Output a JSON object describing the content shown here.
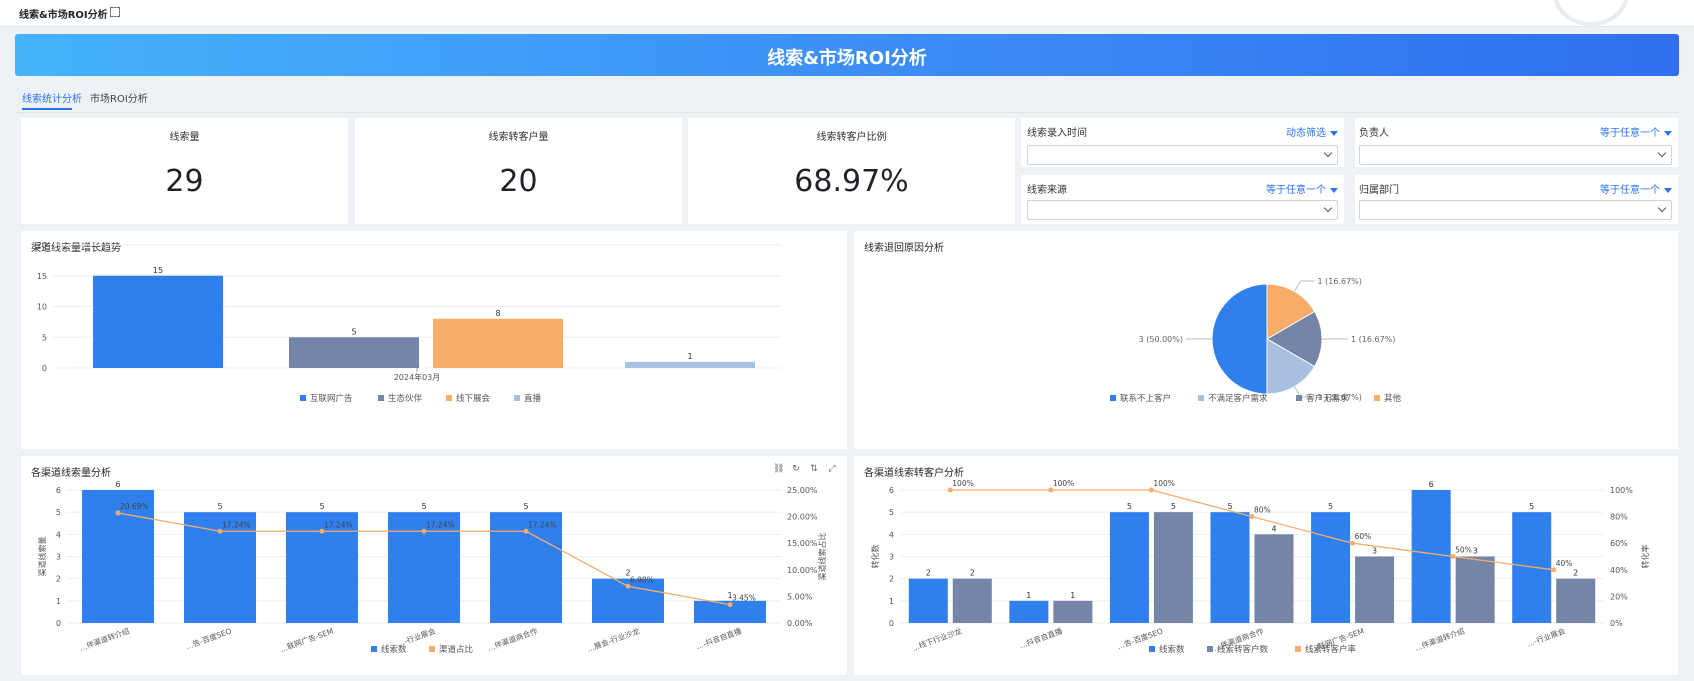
{
  "window": {
    "title": "线索&市场ROI分析"
  },
  "banner": {
    "title": "线索&市场ROI分析"
  },
  "tabs": [
    {
      "label": "线索统计分析",
      "active": true
    },
    {
      "label": "市场ROI分析",
      "active": false
    }
  ],
  "kpis": [
    {
      "title": "线索量",
      "value": "29"
    },
    {
      "title": "线索转客户量",
      "value": "20"
    },
    {
      "title": "线索转客户比例",
      "value": "68.97%"
    }
  ],
  "filters": [
    {
      "label": "线索录入时间",
      "op": "动态筛选"
    },
    {
      "label": "负责人",
      "op": "等于任意一个"
    },
    {
      "label": "线索来源",
      "op": "等于任意一个"
    },
    {
      "label": "归属部门",
      "op": "等于任意一个"
    }
  ],
  "colors": {
    "blue": "#2f7fec",
    "slate": "#7585a8",
    "orange": "#f7ad67",
    "lightblue": "#a8bfe0",
    "accent": "#2a73f0"
  },
  "chart_data": [
    {
      "type": "bar",
      "title": "渠道线索量增长趋势",
      "categories": [
        "2024年03月"
      ],
      "series": [
        {
          "name": "互联网广告",
          "values": [
            15
          ]
        },
        {
          "name": "生态伙伴",
          "values": [
            5
          ]
        },
        {
          "name": "线下展会",
          "values": [
            8
          ]
        },
        {
          "name": "直播",
          "values": [
            1
          ]
        }
      ],
      "yticks": [
        "0",
        "5",
        "10",
        "15",
        "20"
      ],
      "ylim": [
        0,
        20
      ],
      "legend": "bottom"
    },
    {
      "type": "pie",
      "title": "线索退回原因分析",
      "slices": [
        {
          "name": "联系不上客户",
          "value": 3,
          "label": "3 (50.00%)"
        },
        {
          "name": "不满足客户需求",
          "value": 1,
          "label": "1 (16.67%)"
        },
        {
          "name": "客户无需求",
          "value": 1,
          "label": "1 (16.67%)"
        },
        {
          "name": "其他",
          "value": 1,
          "label": "1 (16.67%)"
        }
      ],
      "legend": "bottom"
    },
    {
      "type": "bar",
      "title": "各渠道线索量分析",
      "categories": [
        "生态伙伴-渠道转介绍",
        "互联网广告-百度SEO",
        "互联网广告-SEM",
        "线下展会-行业展会",
        "生态伙伴-渠道商合作",
        "线下展会-行业沙龙",
        "直播-抖音自直播"
      ],
      "category_labels": [
        "…伴渠道转介绍",
        "…告-百度SEO",
        "…联网广告-SEM",
        "…-行业展会",
        "…伴渠道商合作",
        "…展会-行业沙龙",
        "…-抖音自直播"
      ],
      "series": [
        {
          "name": "线索数",
          "type": "bar",
          "values": [
            6,
            5,
            5,
            5,
            5,
            2,
            1
          ]
        },
        {
          "name": "渠道占比",
          "type": "line",
          "values": [
            20.69,
            17.24,
            17.24,
            17.24,
            17.24,
            6.9,
            3.45
          ],
          "labels": [
            "20.69%",
            "17.24%",
            "17.24%",
            "17.24%",
            "17.24%",
            "6.90%",
            "3.45%"
          ]
        }
      ],
      "ylabel": "渠道线索量",
      "y2label": "渠道线索占比",
      "yticks": [
        "0",
        "1",
        "2",
        "3",
        "4",
        "5",
        "6"
      ],
      "y2ticks": [
        "0.00%",
        "5.00%",
        "10.00%",
        "15.00%",
        "20.00%",
        "25.00%"
      ],
      "ylim": [
        0,
        6
      ],
      "y2lim": [
        0,
        25
      ],
      "legend": "bottom"
    },
    {
      "type": "bar",
      "title": "各渠道线索转客户分析",
      "categories": [
        "线下展会-行业沙龙",
        "直播-抖音自直播",
        "互联网广告-百度SEO",
        "生态伙伴-渠道商合作",
        "互联网广告-SEM",
        "生态伙伴-渠道转介绍",
        "线下展会-行业展会"
      ],
      "category_labels": [
        "…线下行业沙龙",
        "…抖音自直播",
        "…告-百度SEO",
        "…伴渠道商合作",
        "…联网广告-SEM",
        "…伴渠道转介绍",
        "…-行业展会"
      ],
      "series": [
        {
          "name": "线索数",
          "type": "bar",
          "values": [
            2,
            1,
            5,
            5,
            5,
            6,
            5
          ]
        },
        {
          "name": "线索转客户数",
          "type": "bar",
          "values": [
            2,
            1,
            5,
            4,
            3,
            3,
            2
          ]
        },
        {
          "name": "线索转客户率",
          "type": "line",
          "values": [
            100,
            100,
            100,
            80,
            60,
            50,
            40
          ],
          "labels": [
            "100%",
            "100%",
            "100%",
            "80%",
            "60%",
            "50%",
            "40%"
          ]
        }
      ],
      "ylabel": "转化数",
      "y2label": "转化率",
      "yticks": [
        "0",
        "1",
        "2",
        "3",
        "4",
        "5",
        "6"
      ],
      "y2ticks": [
        "0%",
        "20%",
        "40%",
        "60%",
        "80%",
        "100%"
      ],
      "ylim": [
        0,
        6
      ],
      "y2lim": [
        0,
        100
      ],
      "legend": "bottom"
    }
  ]
}
